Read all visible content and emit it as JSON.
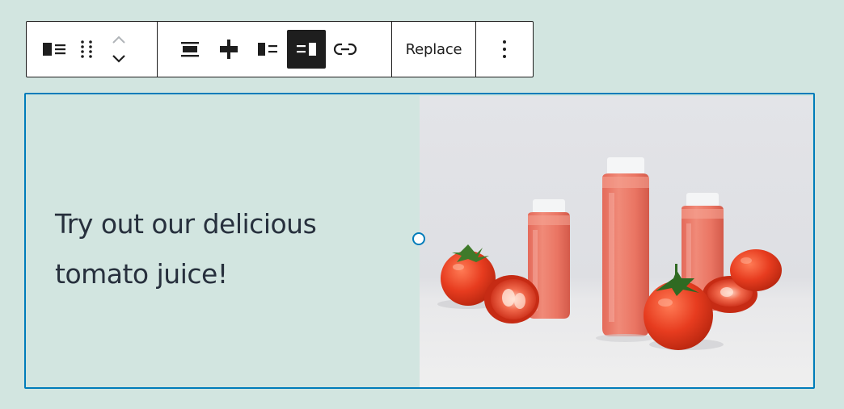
{
  "toolbar": {
    "block_type_icon": "media-text-icon",
    "drag_icon": "drag-handle-icon",
    "move_up_icon": "chevron-up-icon",
    "move_down_icon": "chevron-down-icon",
    "align_icons": [
      "align-center-icon",
      "align-full-width-icon",
      "media-left-icon",
      "media-right-icon"
    ],
    "active_align": "media-right-icon",
    "link_icon": "link-icon",
    "replace_label": "Replace",
    "more_icon": "more-vertical-icon"
  },
  "block": {
    "text": "Try out our delicious tomato juice!",
    "image_icon": "tomato-juice-photo",
    "border_color": "#007cba",
    "background": "#d2e5e0"
  }
}
